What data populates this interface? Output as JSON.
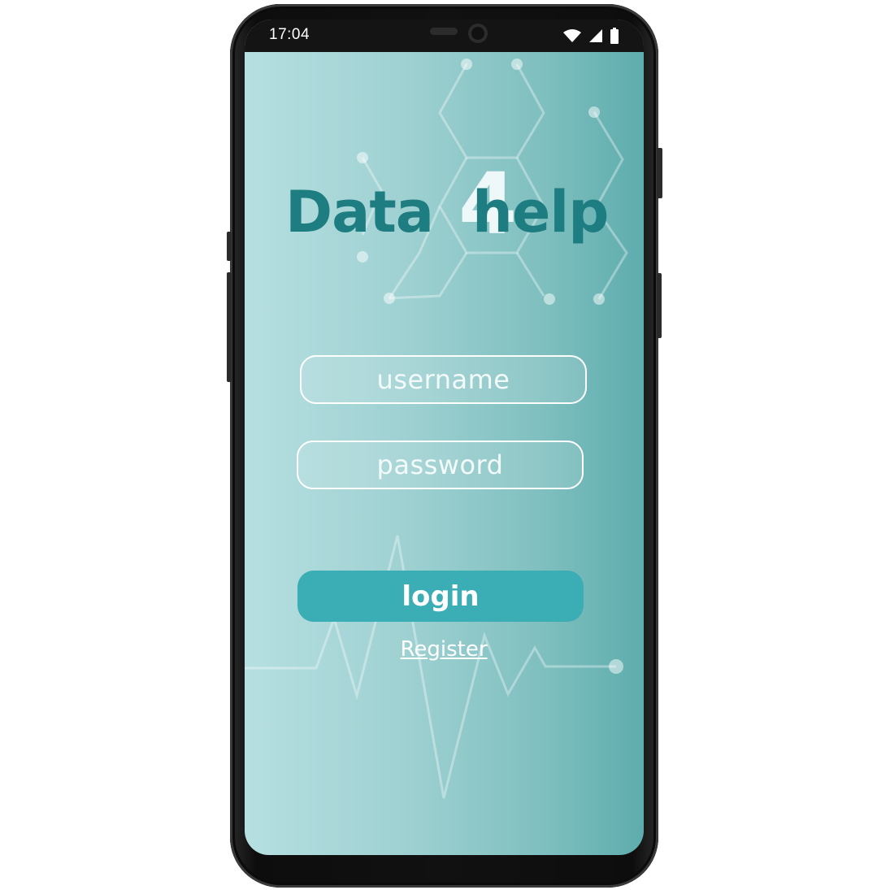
{
  "status_bar": {
    "time": "17:04",
    "icons": [
      "wifi-icon",
      "cellular-signal-icon",
      "battery-icon"
    ]
  },
  "app": {
    "logo_left": "Data",
    "logo_four": "4",
    "logo_right": "help"
  },
  "form": {
    "username_placeholder": "username",
    "password_placeholder": "password",
    "login_label": "login",
    "register_label": "Register"
  },
  "colors": {
    "logo_text": "#1e7d80",
    "login_button": "#3badb4",
    "background_start": "#b6dfe1",
    "background_end": "#5eacad"
  }
}
